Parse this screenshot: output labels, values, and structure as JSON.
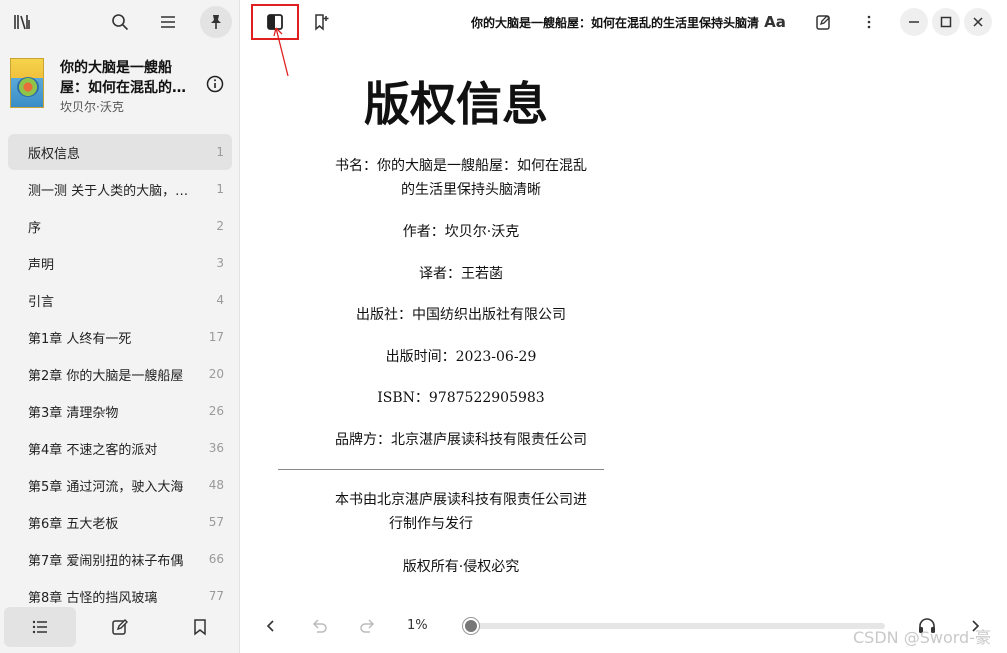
{
  "sidebar": {
    "book": {
      "title": "你的大脑是一艘船屋：如何在混乱的…",
      "author": "坎贝尔·沃克"
    },
    "toc": [
      {
        "label": "版权信息",
        "page": "1",
        "active": true
      },
      {
        "label": "测一测 关于人类的大脑，你…",
        "page": "1"
      },
      {
        "label": "序",
        "page": "2"
      },
      {
        "label": "声明",
        "page": "3"
      },
      {
        "label": "引言",
        "page": "4"
      },
      {
        "label": "第1章 人终有一死",
        "page": "17"
      },
      {
        "label": "第2章 你的大脑是一艘船屋",
        "page": "20"
      },
      {
        "label": "第3章 清理杂物",
        "page": "26"
      },
      {
        "label": "第4章 不速之客的派对",
        "page": "36"
      },
      {
        "label": "第5章 通过河流，驶入大海",
        "page": "48"
      },
      {
        "label": "第6章 五大老板",
        "page": "57"
      },
      {
        "label": "第7章 爱闹别扭的袜子布偶",
        "page": "66"
      },
      {
        "label": "第8章 古怪的挡风玻璃",
        "page": "77"
      }
    ]
  },
  "header": {
    "doc_title": "你的大脑是一艘船屋：如何在混乱的生活里保持头脑清",
    "font_icon_label": "Aa"
  },
  "content": {
    "page_title": "版权信息",
    "book_name_line1": "书名：你的大脑是一艘船屋：如何在混乱",
    "book_name_line2": "的生活里保持头脑清晰",
    "author": "作者：坎贝尔·沃克",
    "translator": "译者：王若菡",
    "publisher": "出版社：中国纺织出版社有限公司",
    "publish_date": "出版时间：2023-06-29",
    "isbn": "ISBN：9787522905983",
    "brand": "品牌方：北京湛庐展读科技有限责任公司",
    "production_line1": "本书由北京湛庐展读科技有限责任公司进",
    "production_line2": "行制作与发行",
    "rights": "版权所有·侵权必究"
  },
  "footer": {
    "percent_label": "1%",
    "progress": 0.01
  },
  "watermark": "CSDN @Sword-豪",
  "colors": {
    "highlight_box": "#e02020",
    "sidebar_bg": "#f3f3f3",
    "active_item_bg": "#e3e3e3"
  },
  "icons": [
    "library-icon",
    "search-icon",
    "menu-icon",
    "pin-icon",
    "info-icon",
    "sidebar-toggle-icon",
    "bookmark-add-icon",
    "font-settings-icon",
    "edit-note-icon",
    "more-icon",
    "minimize-icon",
    "maximize-icon",
    "close-icon",
    "toc-icon",
    "notes-icon",
    "bookmark-icon",
    "prev-page-icon",
    "undo-icon",
    "redo-icon",
    "headphones-icon",
    "next-page-icon"
  ]
}
